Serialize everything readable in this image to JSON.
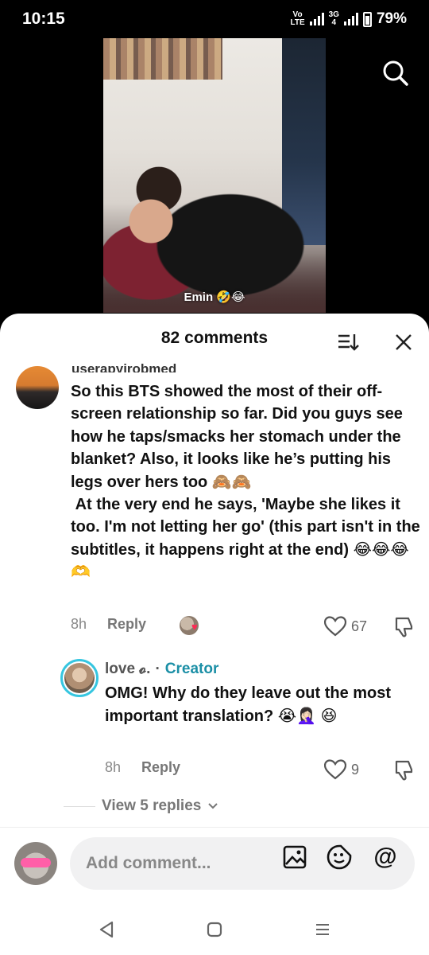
{
  "status_bar": {
    "time": "10:15",
    "network_top": "Vo",
    "network_bottom": "LTE",
    "net_small_top": "3G",
    "net_small_bottom": "4",
    "battery": "79%"
  },
  "video": {
    "caption": "Emin 🤣😂"
  },
  "sheet": {
    "title": "82 comments"
  },
  "comment": {
    "username": "userapyirobmed",
    "text": "So this BTS showed the most of their off-screen relationship so far. Did you guys see how he taps/smacks her stomach under the blanket? Also, it looks like he’s putting his legs over hers too 🙈🙈\n At the very end he says, 'Maybe she likes it too. I'm not letting her go' (this part isn't in the subtitles, it happens right at the end) 😂😂😂🫶",
    "time": "8h",
    "reply_label": "Reply",
    "likes": "67"
  },
  "reply": {
    "author": "love 𝓸.",
    "separator": "·",
    "creator_tag": "Creator",
    "text": "OMG! Why do they leave out the most important translation? 😭🤦🏻‍♀️ 😆",
    "time": "8h",
    "reply_label": "Reply",
    "likes": "9"
  },
  "view_replies": {
    "label": "View 5 replies"
  },
  "input": {
    "placeholder": "Add comment...",
    "mention_symbol": "@"
  },
  "colors": {
    "accent_creator": "#1b8fa6",
    "liked_heart": "#ff2a55"
  }
}
